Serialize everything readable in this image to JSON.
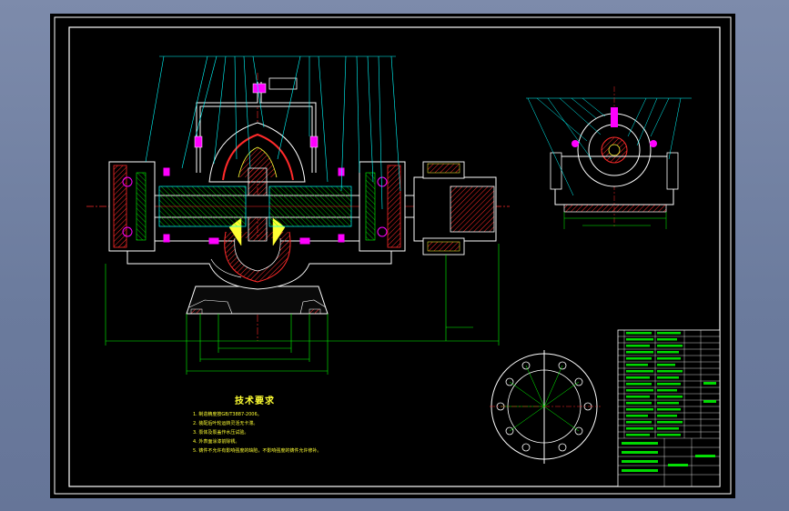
{
  "drawing": {
    "notes_title": "技术要求",
    "notes": [
      "1. 制造精度按GB/T3887-2006。",
      "2. 装配后叶轮运转灵活无卡滞。",
      "3. 泵体及泵盖作水压试验。",
      "4. 外表面涂漆前除锈。",
      "5. 铸件不允许有影响强度的缺陷，不影响强度的铸件允许修补。"
    ],
    "colors": {
      "outline": "#ffffff",
      "leaders": "#00ffff",
      "dims": "#00ff00",
      "hatch": "#ff2a2a",
      "text": "#ffff33",
      "bolts": "#ff00ff",
      "sheet": "#000000",
      "background": "#6f7fa1"
    }
  }
}
